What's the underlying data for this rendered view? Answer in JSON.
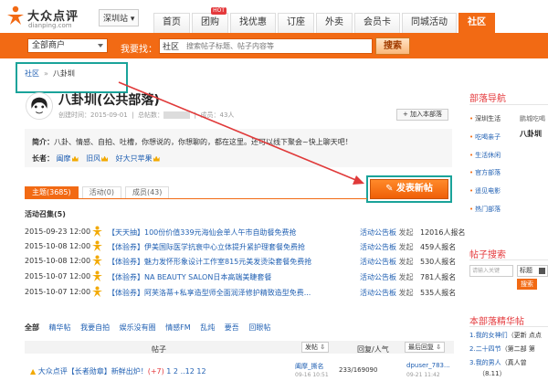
{
  "header": {
    "logo_text": "大众点评",
    "logo_sub": "dianping.com",
    "city": "深圳站",
    "nav_tabs": [
      {
        "label": "首页"
      },
      {
        "label": "团购",
        "badge": "HOT"
      },
      {
        "label": "找优惠"
      },
      {
        "label": "订座"
      },
      {
        "label": "外卖"
      },
      {
        "label": "会员卡"
      },
      {
        "label": "同城活动"
      },
      {
        "label": "社区"
      }
    ],
    "merchant_select": "全部商户",
    "search_label": "我要找：",
    "search_scope": "社区",
    "search_placeholder": "搜索帖子标题、帖子内容等",
    "search_button": "搜索"
  },
  "breadcrumb": {
    "root": "社区",
    "current": "八卦圳"
  },
  "group": {
    "title": "八卦圳(公共部落)",
    "created_label": "创建时间：2015-09-01",
    "total_label": "总帖数：",
    "total_value": "35314帖",
    "members_label": "成员：43人",
    "join_button": "+ 加入本部落",
    "intro_label": "简介：",
    "intro_text": "八卦、情感、自拍、吐槽，你想说的，你想聊的，都在这里。还可以线下聚会~快上聊天吧！",
    "elders_label": "长者：",
    "elders": [
      "阖摩",
      "旧风",
      "好大只苹果"
    ]
  },
  "post_button": "发表新帖",
  "content_tabs": [
    "主题(3685)",
    "活动(0)",
    "成员(43)"
  ],
  "events_title": "活动召集(5)",
  "events": [
    {
      "date": "2015-09-23 12:00",
      "title": "【天天抽】100份价值339元海仙会单人午市自助餐免费抢",
      "by": "活动公告板",
      "action": " 发起",
      "count": "12016人报名"
    },
    {
      "date": "2015-10-08 12:00",
      "title": "【体验券】伊美国际医学抗衰中心立体提升紧护理套餐免费抢",
      "by": "活动公告板",
      "action": " 发起",
      "count": "459人报名"
    },
    {
      "date": "2015-10-08 12:00",
      "title": "【体验券】魅力发怀形象设计工作室815元美发烫染套餐免费抢",
      "by": "活动公告板",
      "action": " 发起",
      "count": "530人报名"
    },
    {
      "date": "2015-10-07 12:00",
      "title": "【体验券】NA BEAUTY SALON日本高端美睫套餐",
      "by": "活动公告板",
      "action": " 发起",
      "count": "781人报名"
    },
    {
      "date": "2015-10-07 12:00",
      "title": "【体验券】阿芙洛蒂+私享造型师全面润泽修护精致造型免费...",
      "by": "活动公告板",
      "action": " 发起",
      "count": "535人报名"
    }
  ],
  "filters": [
    "全部",
    "精华帖",
    "我要自拍",
    "娱乐没有圈",
    "情感FM",
    "乱炖",
    "要吾",
    "回眼帖"
  ],
  "table": {
    "col_post": "帖子",
    "col_author": "发帖",
    "col_stats": "回复/人气",
    "col_last": "最后回复"
  },
  "post": {
    "title": "大众点评【长者勋章】新鲜出炉！",
    "new_count": "(+7)",
    "pages": "1 2 ..12 12",
    "author": "阖摩_撕名",
    "author_date": "09-16 10:51",
    "stats": "233/169090",
    "last_user": "dpuser_783...",
    "last_date": "09-21 11:42"
  },
  "sidebar": {
    "nav_title": "部落导航",
    "nav_items": [
      "深圳生活",
      "吃喝亲子",
      "生活休闲",
      "官方部落",
      "遥见电影",
      "热门部落"
    ],
    "nav_sub": [
      "鹏城吃喝",
      "八卦圳"
    ],
    "search_title": "帖子搜索",
    "search_placeholder": "请输入关键",
    "search_select": "标题",
    "search_button": "搜索",
    "highlights_title": "本部落精华帖",
    "highlights": [
      {
        "n": "1.",
        "text": "我的女神们",
        "tail": "（更新 点点"
      },
      {
        "n": "2.",
        "text": "二十四节",
        "tail": "（第二部 第"
      },
      {
        "n": "3.",
        "text": "我的男人",
        "tail": "（真人曾",
        "date": "（8.11）"
      }
    ]
  },
  "colors": {
    "accent": "#f26a14",
    "link": "#2261b3",
    "annotation": "#1aa39a",
    "arrow": "#e03a3a"
  }
}
